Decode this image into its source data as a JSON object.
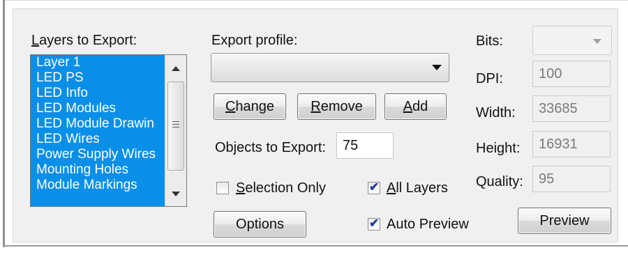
{
  "layers": {
    "label": "Layers to Export:",
    "items": [
      "Layer 1",
      "LED PS",
      "LED Info",
      "LED Modules",
      "LED Module Drawin",
      "LED Wires",
      "Power Supply Wires",
      "Mounting Holes",
      "Module Markings"
    ]
  },
  "profile": {
    "label": "Export profile:",
    "value": ""
  },
  "buttons": {
    "change": "Change",
    "remove": "Remove",
    "add": "Add",
    "options": "Options",
    "preview": "Preview"
  },
  "objects": {
    "label": "Objects to Export:",
    "value": "75"
  },
  "checkboxes": {
    "selection_only": {
      "label": "Selection Only",
      "checked": false
    },
    "all_layers": {
      "label": "All Layers",
      "checked": true
    },
    "auto_preview": {
      "label": "Auto Preview",
      "checked": true
    }
  },
  "settings": {
    "bits_label": "Bits:",
    "bits_value": "",
    "dpi_label": "DPI:",
    "dpi_value": "100",
    "width_label": "Width:",
    "width_value": "33685",
    "height_label": "Height:",
    "height_value": "16931",
    "quality_label": "Quality:",
    "quality_value": "95"
  },
  "colors": {
    "selection": "#0a8fe8",
    "panel": "#f0f0f0",
    "check": "#1d3d9a"
  }
}
